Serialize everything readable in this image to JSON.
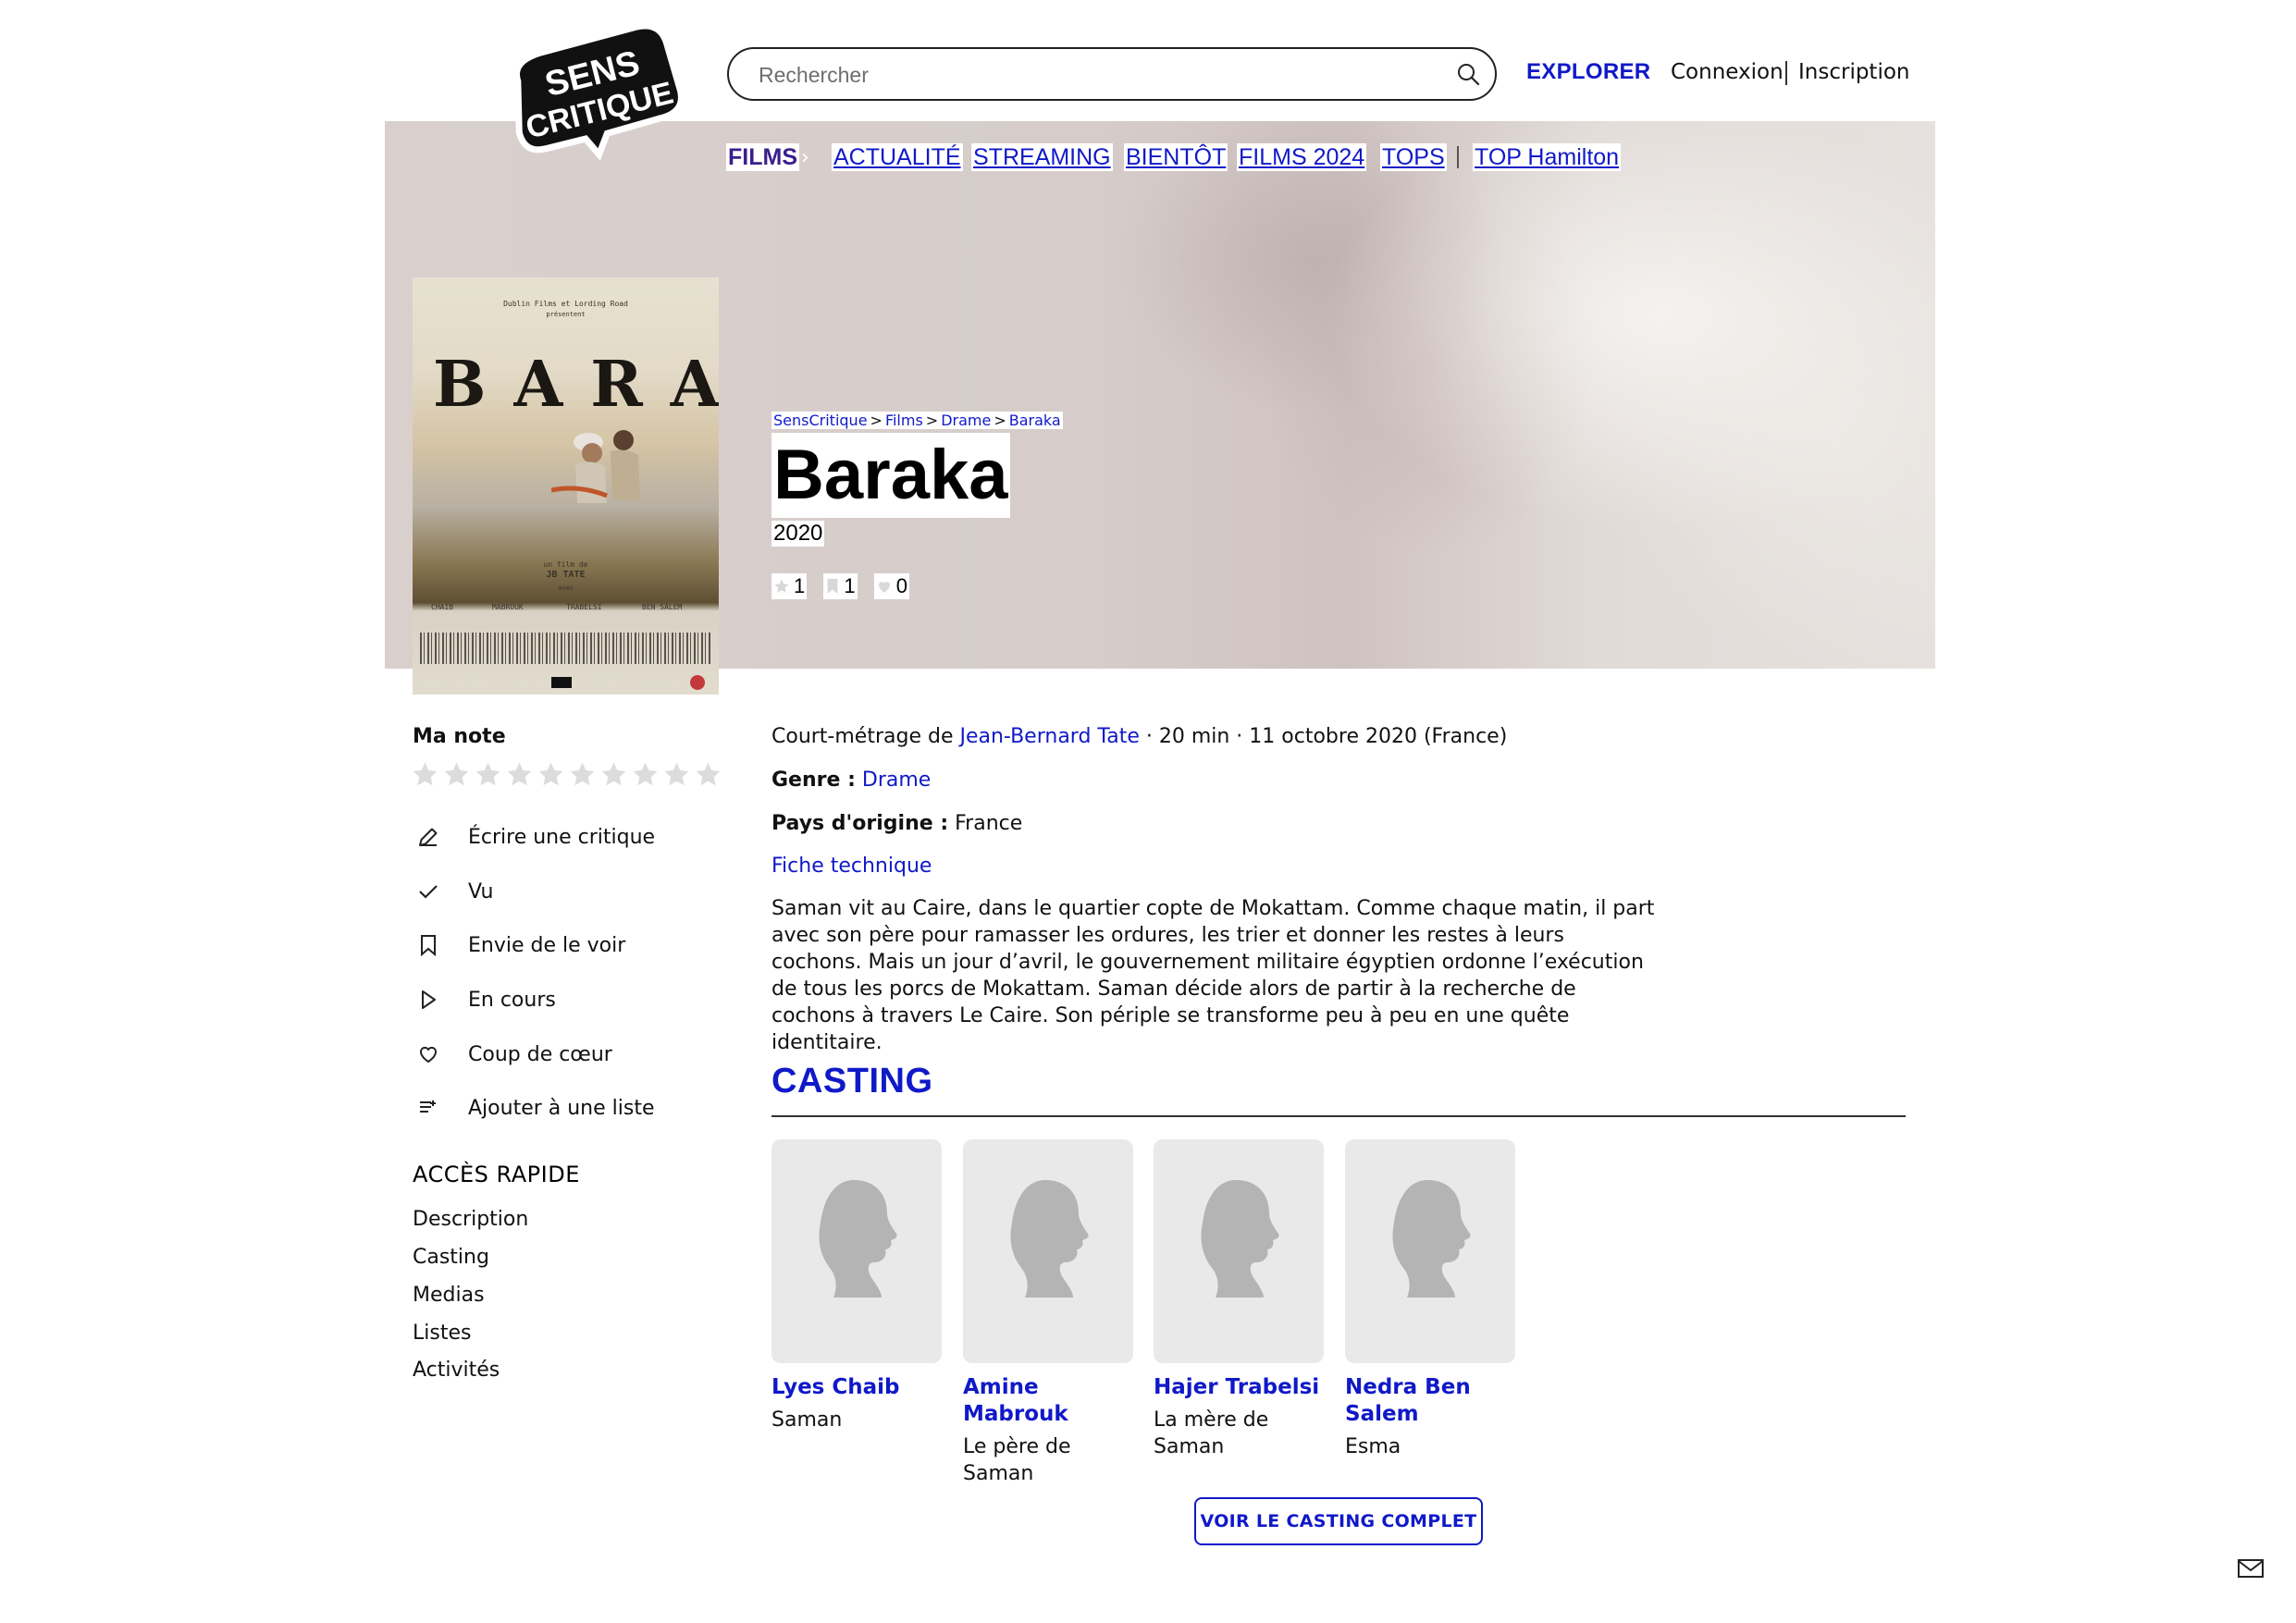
{
  "header": {
    "logo_text_top": "SENS",
    "logo_text_bottom": "CRITIQUE",
    "search_placeholder": "Rechercher",
    "explore_label": "EXPLORER",
    "login_label": "Connexion",
    "signup_label": "Inscription"
  },
  "nav": {
    "films": "FILMS",
    "chevron": "›",
    "items": [
      "ACTUALITÉ",
      "STREAMING",
      "BIENTÔT",
      "FILMS 2024",
      "TOPS",
      "TOP Hamilton"
    ]
  },
  "poster": {
    "presenters": "Dublin Films et Lording Road",
    "presents": "présentent",
    "title": "BARAKA",
    "director_line": "un film de",
    "director": "JB TATE",
    "with": "avec",
    "cast": [
      "CHAIB",
      "MABROUK",
      "TRABELSI",
      "BEN SALEM"
    ]
  },
  "breadcrumb": [
    "SensCritique",
    "Films",
    "Drame",
    "Baraka"
  ],
  "breadcrumb_sep": ">",
  "movie": {
    "title": "Baraka",
    "year": "2020",
    "stats": {
      "ratings": "1",
      "wishlist": "1",
      "favorites": "0"
    }
  },
  "sidebar": {
    "my_rating_label": "Ma note",
    "rating_scale": 10,
    "actions": [
      {
        "icon": "pencil-icon",
        "label": "Écrire une critique"
      },
      {
        "icon": "check-icon",
        "label": "Vu"
      },
      {
        "icon": "bookmark-icon",
        "label": "Envie de le voir"
      },
      {
        "icon": "play-icon",
        "label": "En cours"
      },
      {
        "icon": "heart-icon",
        "label": "Coup de cœur"
      },
      {
        "icon": "add-list-icon",
        "label": "Ajouter à une liste"
      }
    ],
    "quick_access_title": "ACCÈS RAPIDE",
    "quick_links": [
      "Description",
      "Casting",
      "Medias",
      "Listes",
      "Activités"
    ]
  },
  "info": {
    "type_prefix": "Court-métrage de ",
    "director": "Jean-Bernard Tate",
    "details": " · 20 min · 11 octobre 2020 (France)",
    "genre_label": "Genre :",
    "genre": "Drame",
    "country_label": "Pays d'origine :",
    "country": "France",
    "tech_sheet": "Fiche technique",
    "synopsis": "Saman vit au Caire, dans le quartier copte de Mokattam. Comme chaque matin, il part avec son père pour ramasser les ordures, les trier et donner les restes à leurs cochons. Mais un jour d’avril, le gouvernement militaire égyptien ordonne l’exécution de tous les porcs de Mokattam. Saman décide alors de partir à la recherche de cochons à travers Le Caire. Son périple se transforme peu à peu en une quête identitaire."
  },
  "casting": {
    "title": "CASTING",
    "members": [
      {
        "name": "Lyes Chaib",
        "role": "Saman"
      },
      {
        "name": "Amine Mabrouk",
        "role": "Le père de Saman"
      },
      {
        "name": "Hajer Trabelsi",
        "role": "La mère de Saman"
      },
      {
        "name": "Nedra Ben Salem",
        "role": "Esma"
      }
    ],
    "full_cast_button": "VOIR LE CASTING COMPLET"
  },
  "colors": {
    "accent_blue": "#1019c8",
    "films_purple": "#3a1f8c",
    "star_empty": "#dcdcdc"
  }
}
